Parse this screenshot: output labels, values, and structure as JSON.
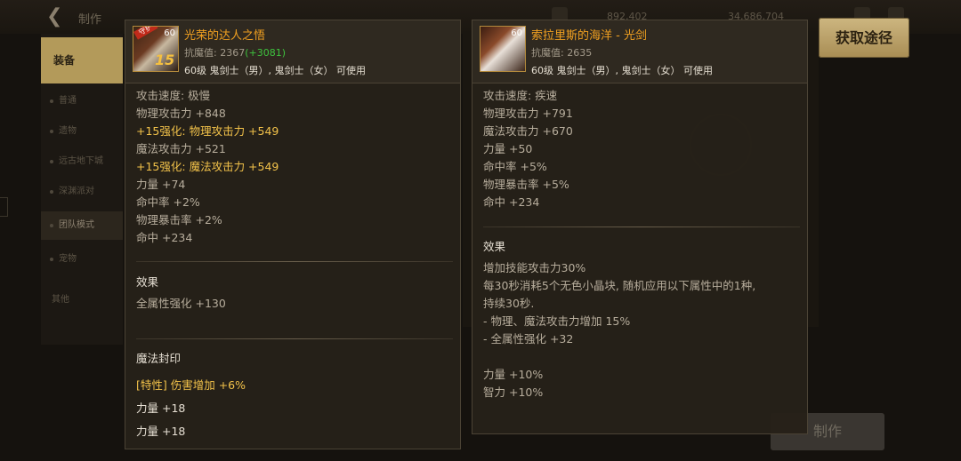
{
  "background": {
    "top_title": "制作",
    "currency_left": "892,402",
    "currency_right": "34,686,704",
    "sidebar_items": [
      "装备",
      "普通",
      "遗物",
      "远古地下城",
      "深渊派对",
      "团队模式",
      "宠物",
      "其他"
    ],
    "make_button": "制作"
  },
  "get_source_button": "获取途径",
  "item1": {
    "name": "光荣的达人之悟",
    "level_badge": "60",
    "upgrade_badge": "15",
    "corner_tag": "守护",
    "resist_label": "抗魔值: 2367",
    "resist_bonus": "(+3081)",
    "requirement": "60级 鬼剑士（男）, 鬼剑士（女） 可使用",
    "stats": [
      {
        "text": "攻击速度: 极慢",
        "style": "normal"
      },
      {
        "text": "物理攻击力 +848",
        "style": "normal"
      },
      {
        "text": "+15强化: 物理攻击力 +549",
        "style": "gold"
      },
      {
        "text": "魔法攻击力 +521",
        "style": "normal"
      },
      {
        "text": "+15强化: 魔法攻击力 +549",
        "style": "gold"
      },
      {
        "text": "力量 +74",
        "style": "normal"
      },
      {
        "text": "命中率 +2%",
        "style": "normal"
      },
      {
        "text": "物理暴击率 +2%",
        "style": "normal"
      },
      {
        "text": "命中 +234",
        "style": "normal"
      }
    ],
    "effect_title": "效果",
    "effect_lines": [
      "全属性强化 +130"
    ],
    "seal_title": "魔法封印",
    "seal_lines": [
      {
        "text": "[特性] 伤害增加 +6%",
        "style": "gold"
      },
      {
        "text": "力量 +18",
        "style": "white"
      },
      {
        "text": "力量 +18",
        "style": "white"
      }
    ]
  },
  "item2": {
    "name": "索拉里斯的海洋 - 光剑",
    "level_badge": "60",
    "resist_label": "抗魔值: 2635",
    "requirement": "60级 鬼剑士（男）, 鬼剑士（女） 可使用",
    "stats": [
      "攻击速度: 疾速",
      "物理攻击力 +791",
      "魔法攻击力 +670",
      "力量 +50",
      "命中率 +5%",
      "物理暴击率 +5%",
      "命中 +234"
    ],
    "effect_title": "效果",
    "effect_lines": [
      "增加技能攻击力30%",
      "每30秒消耗5个无色小晶块, 随机应用以下属性中的1种,",
      "持续30秒.",
      " - 物理、魔法攻击力增加 15%",
      " - 全属性强化 +32",
      "",
      "力量 +10%",
      "智力 +10%"
    ]
  }
}
